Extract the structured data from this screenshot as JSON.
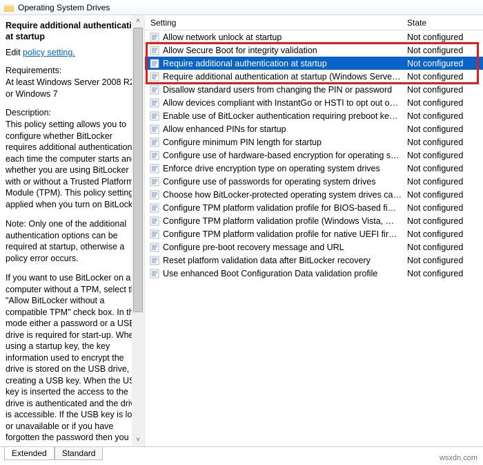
{
  "window": {
    "title": "Operating System Drives"
  },
  "left": {
    "policy_title": "Require additional authentication at startup",
    "edit_prefix": "Edit ",
    "edit_link": "policy setting.",
    "req_head": "Requirements:",
    "req_body": "At least Windows Server 2008 R2 or Windows 7",
    "desc_head": "Description:",
    "desc_p1": "This policy setting allows you to configure whether BitLocker requires additional authentication each time the computer starts and whether you are using BitLocker with or without a Trusted Platform Module (TPM). This policy setting is applied when you turn on BitLocker.",
    "desc_p2": "Note: Only one of the additional authentication options can be required at startup, otherwise a policy error occurs.",
    "desc_p3": "If you want to use BitLocker on a computer without a TPM, select the \"Allow BitLocker without a compatible TPM\" check box. In this mode either a password or a USB drive is required for start-up. When using a startup key, the key information used to encrypt the drive is stored on the USB drive, creating a USB key. When the USB key is inserted the access to the drive is authenticated and the drive is accessible. If the USB key is lost or unavailable or if you have forgotten the password then you"
  },
  "columns": {
    "setting": "Setting",
    "state": "State"
  },
  "settings": [
    {
      "label": "Allow network unlock at startup",
      "state": "Not configured",
      "selected": false
    },
    {
      "label": "Allow Secure Boot for integrity validation",
      "state": "Not configured",
      "selected": false
    },
    {
      "label": "Require additional authentication at startup",
      "state": "Not configured",
      "selected": true
    },
    {
      "label": "Require additional authentication at startup (Windows Serve…",
      "state": "Not configured",
      "selected": false
    },
    {
      "label": "Disallow standard users from changing the PIN or password",
      "state": "Not configured",
      "selected": false
    },
    {
      "label": "Allow devices compliant with InstantGo or HSTI to opt out o…",
      "state": "Not configured",
      "selected": false
    },
    {
      "label": "Enable use of BitLocker authentication requiring preboot ke…",
      "state": "Not configured",
      "selected": false
    },
    {
      "label": "Allow enhanced PINs for startup",
      "state": "Not configured",
      "selected": false
    },
    {
      "label": "Configure minimum PIN length for startup",
      "state": "Not configured",
      "selected": false
    },
    {
      "label": "Configure use of hardware-based encryption for operating s…",
      "state": "Not configured",
      "selected": false
    },
    {
      "label": "Enforce drive encryption type on operating system drives",
      "state": "Not configured",
      "selected": false
    },
    {
      "label": "Configure use of passwords for operating system drives",
      "state": "Not configured",
      "selected": false
    },
    {
      "label": "Choose how BitLocker-protected operating system drives ca…",
      "state": "Not configured",
      "selected": false
    },
    {
      "label": "Configure TPM platform validation profile for BIOS-based fi…",
      "state": "Not configured",
      "selected": false
    },
    {
      "label": "Configure TPM platform validation profile (Windows Vista, …",
      "state": "Not configured",
      "selected": false
    },
    {
      "label": "Configure TPM platform validation profile for native UEFI fir…",
      "state": "Not configured",
      "selected": false
    },
    {
      "label": "Configure pre-boot recovery message and URL",
      "state": "Not configured",
      "selected": false
    },
    {
      "label": "Reset platform validation data after BitLocker recovery",
      "state": "Not configured",
      "selected": false
    },
    {
      "label": "Use enhanced Boot Configuration Data validation profile",
      "state": "Not configured",
      "selected": false
    }
  ],
  "tabs": {
    "extended": "Extended",
    "standard": "Standard"
  },
  "watermark": "wsxdn.com"
}
